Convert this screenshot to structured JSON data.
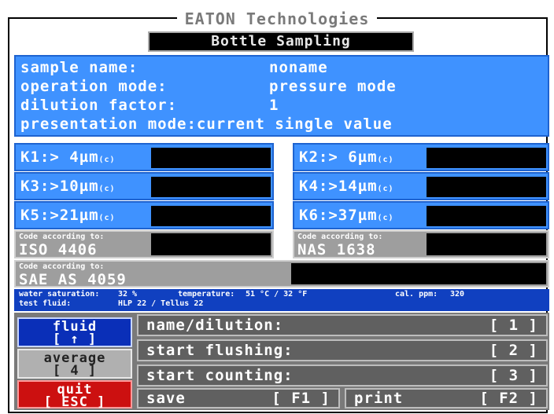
{
  "header": {
    "title": "EATON Technologies",
    "subtitle": "Bottle Sampling"
  },
  "info": [
    {
      "label": "sample name:",
      "value": "noname"
    },
    {
      "label": "operation mode:",
      "value": "pressure mode"
    },
    {
      "label": "dilution factor:",
      "value": "1"
    },
    {
      "label": "presentation mode:",
      "value": "current single value"
    }
  ],
  "counts": [
    {
      "label": "K1:> 4µm",
      "unit": "(c)"
    },
    {
      "label": "K2:> 6µm",
      "unit": "(c)"
    },
    {
      "label": "K3:>10µm",
      "unit": "(c)"
    },
    {
      "label": "K4:>14µm",
      "unit": "(c)"
    },
    {
      "label": "K5:>21µm",
      "unit": "(c)"
    },
    {
      "label": "K6:>37µm",
      "unit": "(c)"
    }
  ],
  "codes": [
    {
      "caption": "Code according to:",
      "standard": "ISO 4406"
    },
    {
      "caption": "Code according to:",
      "standard": "NAS 1638"
    },
    {
      "caption": "Code according to:",
      "standard": "SAE AS 4059"
    }
  ],
  "status": {
    "water_label": "water saturation:",
    "water_value": "32 %",
    "temp_label": "temperature:",
    "temp_value": "51 °C /  32 °F",
    "cal_label": "cal. ppm:",
    "cal_value": "320",
    "fluid_label": "test fluid:",
    "fluid_value": "HLP 22 / Tellus 22"
  },
  "buttons": {
    "fluid": {
      "label": "fluid",
      "key": "[ ↑ ]"
    },
    "average": {
      "label": "average",
      "key": "[ 4 ]"
    },
    "quit": {
      "label": "quit",
      "key": "[ ESC ]"
    }
  },
  "menu": [
    {
      "label": "name/dilution:",
      "key": "[ 1 ]"
    },
    {
      "label": "start flushing:",
      "key": "[ 2 ]"
    },
    {
      "label": "start counting:",
      "key": "[ 3 ]"
    }
  ],
  "footer": {
    "save_label": "save",
    "save_key": "[ F1 ]",
    "print_label": "print",
    "print_key": "[ F2 ]"
  },
  "colors": {
    "panel_blue": "#3f92ff",
    "status_blue": "#1040c0",
    "quit_red": "#cc1010",
    "fluid_blue": "#0a2fb8",
    "gray": "#9e9e9e"
  }
}
